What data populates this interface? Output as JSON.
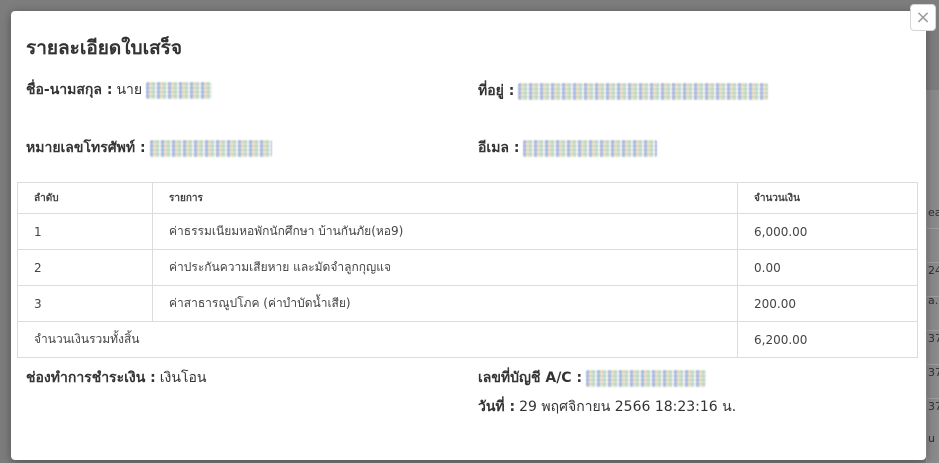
{
  "background": {
    "fragments": [
      "ea",
      "24",
      "a.",
      "37",
      "37",
      "37",
      "u"
    ]
  },
  "modal": {
    "close_label": "×",
    "title": "รายละเอียดใบเสร็จ",
    "name": {
      "label": "ชื่อ-นามสกุล :",
      "prefix": "นาย"
    },
    "address": {
      "label": "ที่อยู่ :"
    },
    "phone": {
      "label": "หมายเลขโทรศัพท์ :"
    },
    "email": {
      "label": "อีเมล :"
    },
    "table": {
      "headers": [
        "ลำดับ",
        "รายการ",
        "จำนวนเงิน"
      ],
      "rows": [
        {
          "no": "1",
          "item": "ค่าธรรมเนียมหอพักนักศึกษา บ้านกันภัย(หอ9)",
          "amount": "6,000.00"
        },
        {
          "no": "2",
          "item": "ค่าประกันความเสียหาย และมัดจำลูกกุญแจ",
          "amount": "0.00"
        },
        {
          "no": "3",
          "item": "ค่าสาธารณูปโภค (ค่าบำบัดน้ำเสีย)",
          "amount": "200.00"
        }
      ],
      "total_label": "จำนวนเงินรวมทั้งสิ้น",
      "total_amount": "6,200.00"
    },
    "payment": {
      "label": "ช่องทำการชำระเงิน :",
      "value": "เงินโอน"
    },
    "account": {
      "label": "เลขที่บัญชี A/C :"
    },
    "date": {
      "label": "วันที่ :",
      "value": "29 พฤศจิกายน 2566 18:23:16 น."
    }
  }
}
